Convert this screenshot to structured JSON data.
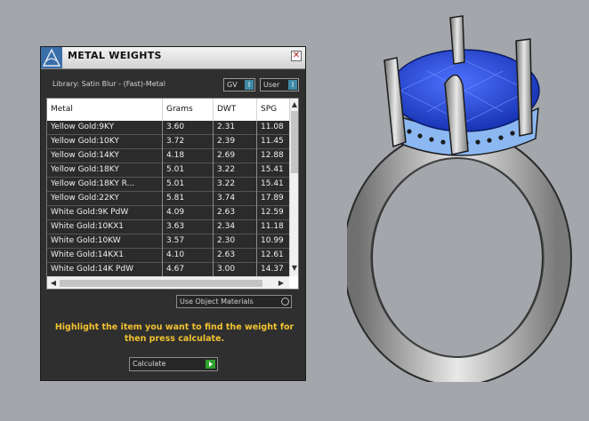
{
  "panel": {
    "title": "METAL WEIGHTS",
    "close_glyph": "✕",
    "library_label": "Library: Satin Blur - (Fast)-Metal",
    "toggles": [
      {
        "label": "GV",
        "indicator": "I"
      },
      {
        "label": "User",
        "indicator": "I"
      }
    ]
  },
  "table": {
    "columns": [
      "Metal",
      "Grams",
      "DWT",
      "SPG"
    ],
    "rows": [
      [
        "Yellow Gold:9KY",
        "3.60",
        "2.31",
        "11.08"
      ],
      [
        "Yellow Gold:10KY",
        "3.72",
        "2.39",
        "11.45"
      ],
      [
        "Yellow Gold:14KY",
        "4.18",
        "2.69",
        "12.88"
      ],
      [
        "Yellow Gold:18KY",
        "5.01",
        "3.22",
        "15.41"
      ],
      [
        "Yellow Gold:18KY R...",
        "5.01",
        "3.22",
        "15.41"
      ],
      [
        "Yellow Gold:22KY",
        "5.81",
        "3.74",
        "17.89"
      ],
      [
        "White Gold:9K PdW",
        "4.09",
        "2.63",
        "12.59"
      ],
      [
        "White Gold:10KX1",
        "3.63",
        "2.34",
        "11.18"
      ],
      [
        "White Gold:10KW",
        "3.57",
        "2.30",
        "10.99"
      ],
      [
        "White Gold:14KX1",
        "4.10",
        "2.63",
        "12.61"
      ],
      [
        "White Gold:14K PdW",
        "4.67",
        "3.00",
        "14.37"
      ]
    ],
    "scroll_up": "▲",
    "scroll_down": "▼",
    "scroll_left": "◀",
    "scroll_right": "▶"
  },
  "controls": {
    "use_object_materials": "Use Object Materials",
    "instructions": "Highlight the item you want to find the weight for then press calculate.",
    "calculate": "Calculate"
  },
  "colors": {
    "viewport_bg": "#a3a7ab",
    "panel_bg": "#2f2f2f",
    "accent_yellow": "#f2c230",
    "toggle_blue": "#3e8aa6",
    "play_green": "#2fa12f",
    "gem_blue": "#1d3fcf"
  },
  "icons": {
    "logo": "rhino-logo-icon",
    "close": "close-icon",
    "calculate": "play-icon"
  }
}
